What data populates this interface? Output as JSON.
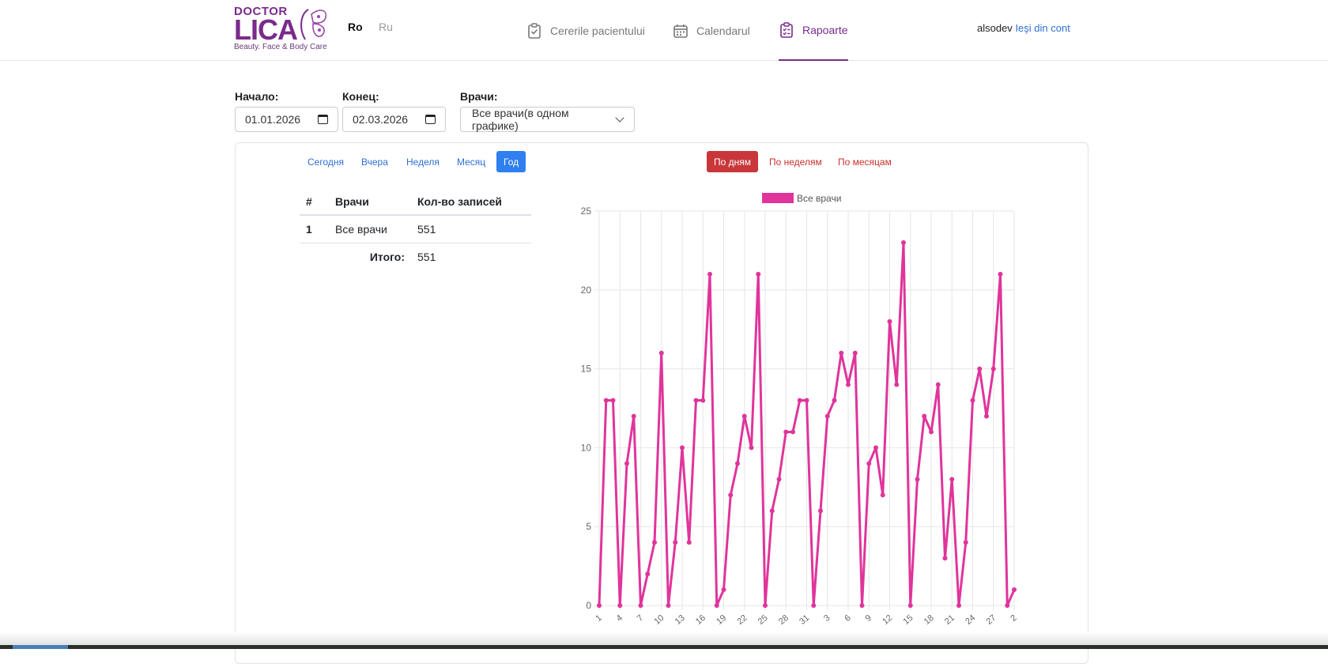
{
  "header": {
    "logo": {
      "line1": "DOCTOR",
      "line2": "LICA",
      "tagline": "Beauty. Face & Body Care"
    },
    "languages": [
      {
        "label": "Ro",
        "active": true
      },
      {
        "label": "Ru",
        "active": false
      }
    ],
    "nav": [
      {
        "label": "Cererile pacientului",
        "icon": "clipboard-check-icon",
        "active": false
      },
      {
        "label": "Calendarul",
        "icon": "calendar-icon",
        "active": false
      },
      {
        "label": "Rapoarte",
        "icon": "clipboard-list-icon",
        "active": true
      }
    ],
    "user": {
      "name": "alsodev",
      "logout": "Ieşi din cont"
    }
  },
  "filters": {
    "start": {
      "label": "Начало:",
      "value": "01.01.2026"
    },
    "end": {
      "label": "Конец:",
      "value": "02.03.2026"
    },
    "doctors": {
      "label": "Врачи:",
      "value": "Все врачи(в одном графике)"
    }
  },
  "periods": [
    {
      "label": "Сегодня",
      "active": false
    },
    {
      "label": "Вчера",
      "active": false
    },
    {
      "label": "Неделя",
      "active": false
    },
    {
      "label": "Месяц",
      "active": false
    },
    {
      "label": "Год",
      "active": true
    }
  ],
  "groupings": [
    {
      "label": "По дням",
      "active": true
    },
    {
      "label": "По неделям",
      "active": false
    },
    {
      "label": "По месяцам",
      "active": false
    }
  ],
  "table": {
    "headers": [
      "#",
      "Врачи",
      "Кол-во записей"
    ],
    "rows": [
      {
        "num": "1",
        "doctor": "Все врачи",
        "count": "551"
      }
    ],
    "total_label": "Итого:",
    "total_value": "551"
  },
  "colors": {
    "accent": "#7b2a8c",
    "series": "#e0349b",
    "primary": "#2f7ff0",
    "danger": "#c9373a"
  },
  "chart_data": {
    "type": "line",
    "legend": "Все врачи",
    "legend_position": "top",
    "ylim": [
      0,
      25
    ],
    "yticks": [
      0,
      5,
      10,
      15,
      20,
      25
    ],
    "grid": true,
    "x": [
      1,
      2,
      3,
      4,
      5,
      6,
      7,
      8,
      9,
      10,
      11,
      12,
      13,
      14,
      15,
      16,
      17,
      18,
      19,
      20,
      21,
      22,
      23,
      24,
      25,
      26,
      27,
      28,
      29,
      30,
      31,
      1,
      2,
      3,
      4,
      5,
      6,
      7,
      8,
      9,
      10,
      11,
      12,
      13,
      14,
      15,
      16,
      17,
      18,
      19,
      20,
      21,
      22,
      23,
      24,
      25,
      26,
      27,
      28,
      1,
      2
    ],
    "xtick_labels": [
      "1",
      "4",
      "7",
      "10",
      "13",
      "16",
      "19",
      "22",
      "25",
      "28",
      "31",
      "3",
      "6",
      "9",
      "12",
      "15",
      "18",
      "21",
      "24",
      "27",
      "2"
    ],
    "series": [
      {
        "name": "Все врачи",
        "values": [
          0,
          13,
          13,
          0,
          9,
          12,
          0,
          2,
          4,
          16,
          0,
          4,
          10,
          4,
          13,
          13,
          21,
          0,
          1,
          7,
          9,
          12,
          10,
          21,
          0,
          6,
          8,
          11,
          11,
          13,
          13,
          0,
          6,
          12,
          13,
          16,
          14,
          16,
          0,
          9,
          10,
          7,
          18,
          14,
          23,
          0,
          8,
          12,
          11,
          14,
          3,
          8,
          0,
          4,
          13,
          15,
          12,
          15,
          21,
          0,
          1
        ]
      }
    ]
  }
}
